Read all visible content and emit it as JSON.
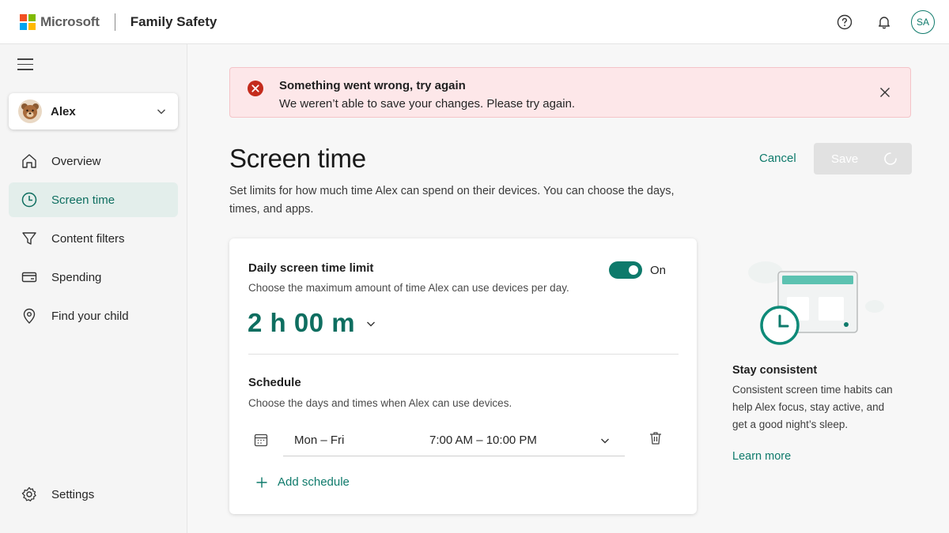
{
  "header": {
    "brand": "Microsoft",
    "app_name": "Family Safety",
    "avatar_initials": "SA"
  },
  "sidebar": {
    "profile_name": "Alex",
    "items": [
      {
        "label": "Overview",
        "icon": "home-icon"
      },
      {
        "label": "Screen time",
        "icon": "clock-icon",
        "active": true
      },
      {
        "label": "Content filters",
        "icon": "filter-icon"
      },
      {
        "label": "Spending",
        "icon": "card-icon"
      },
      {
        "label": "Find your child",
        "icon": "location-pin-icon"
      }
    ],
    "settings_label": "Settings"
  },
  "error": {
    "title": "Something went wrong, try again",
    "message": "We weren’t able to save your changes. Please try again."
  },
  "page": {
    "title": "Screen time",
    "description": "Set limits for how much time Alex can spend on their devices. You can choose the days, times, and apps.",
    "cancel_label": "Cancel",
    "save_label": "Save"
  },
  "limit_card": {
    "heading": "Daily screen time limit",
    "subtitle": "Choose the maximum amount of time Alex can use devices per day.",
    "toggle_label": "On",
    "toggle_on": true,
    "time_value": "2 h 00 m",
    "schedule_heading": "Schedule",
    "schedule_subtitle": "Choose the days and times when Alex can use devices.",
    "schedule": {
      "days": "Mon – Fri",
      "times": "7:00 AM – 10:00 PM"
    },
    "add_schedule_label": "Add schedule"
  },
  "tip": {
    "title": "Stay consistent",
    "body": "Consistent screen time habits can help Alex focus, stay active, and get a good night’s sleep.",
    "link": "Learn more"
  },
  "colors": {
    "accent": "#0e7a6b",
    "error_bg": "#fde7e9",
    "error_icon": "#c42b1c"
  }
}
